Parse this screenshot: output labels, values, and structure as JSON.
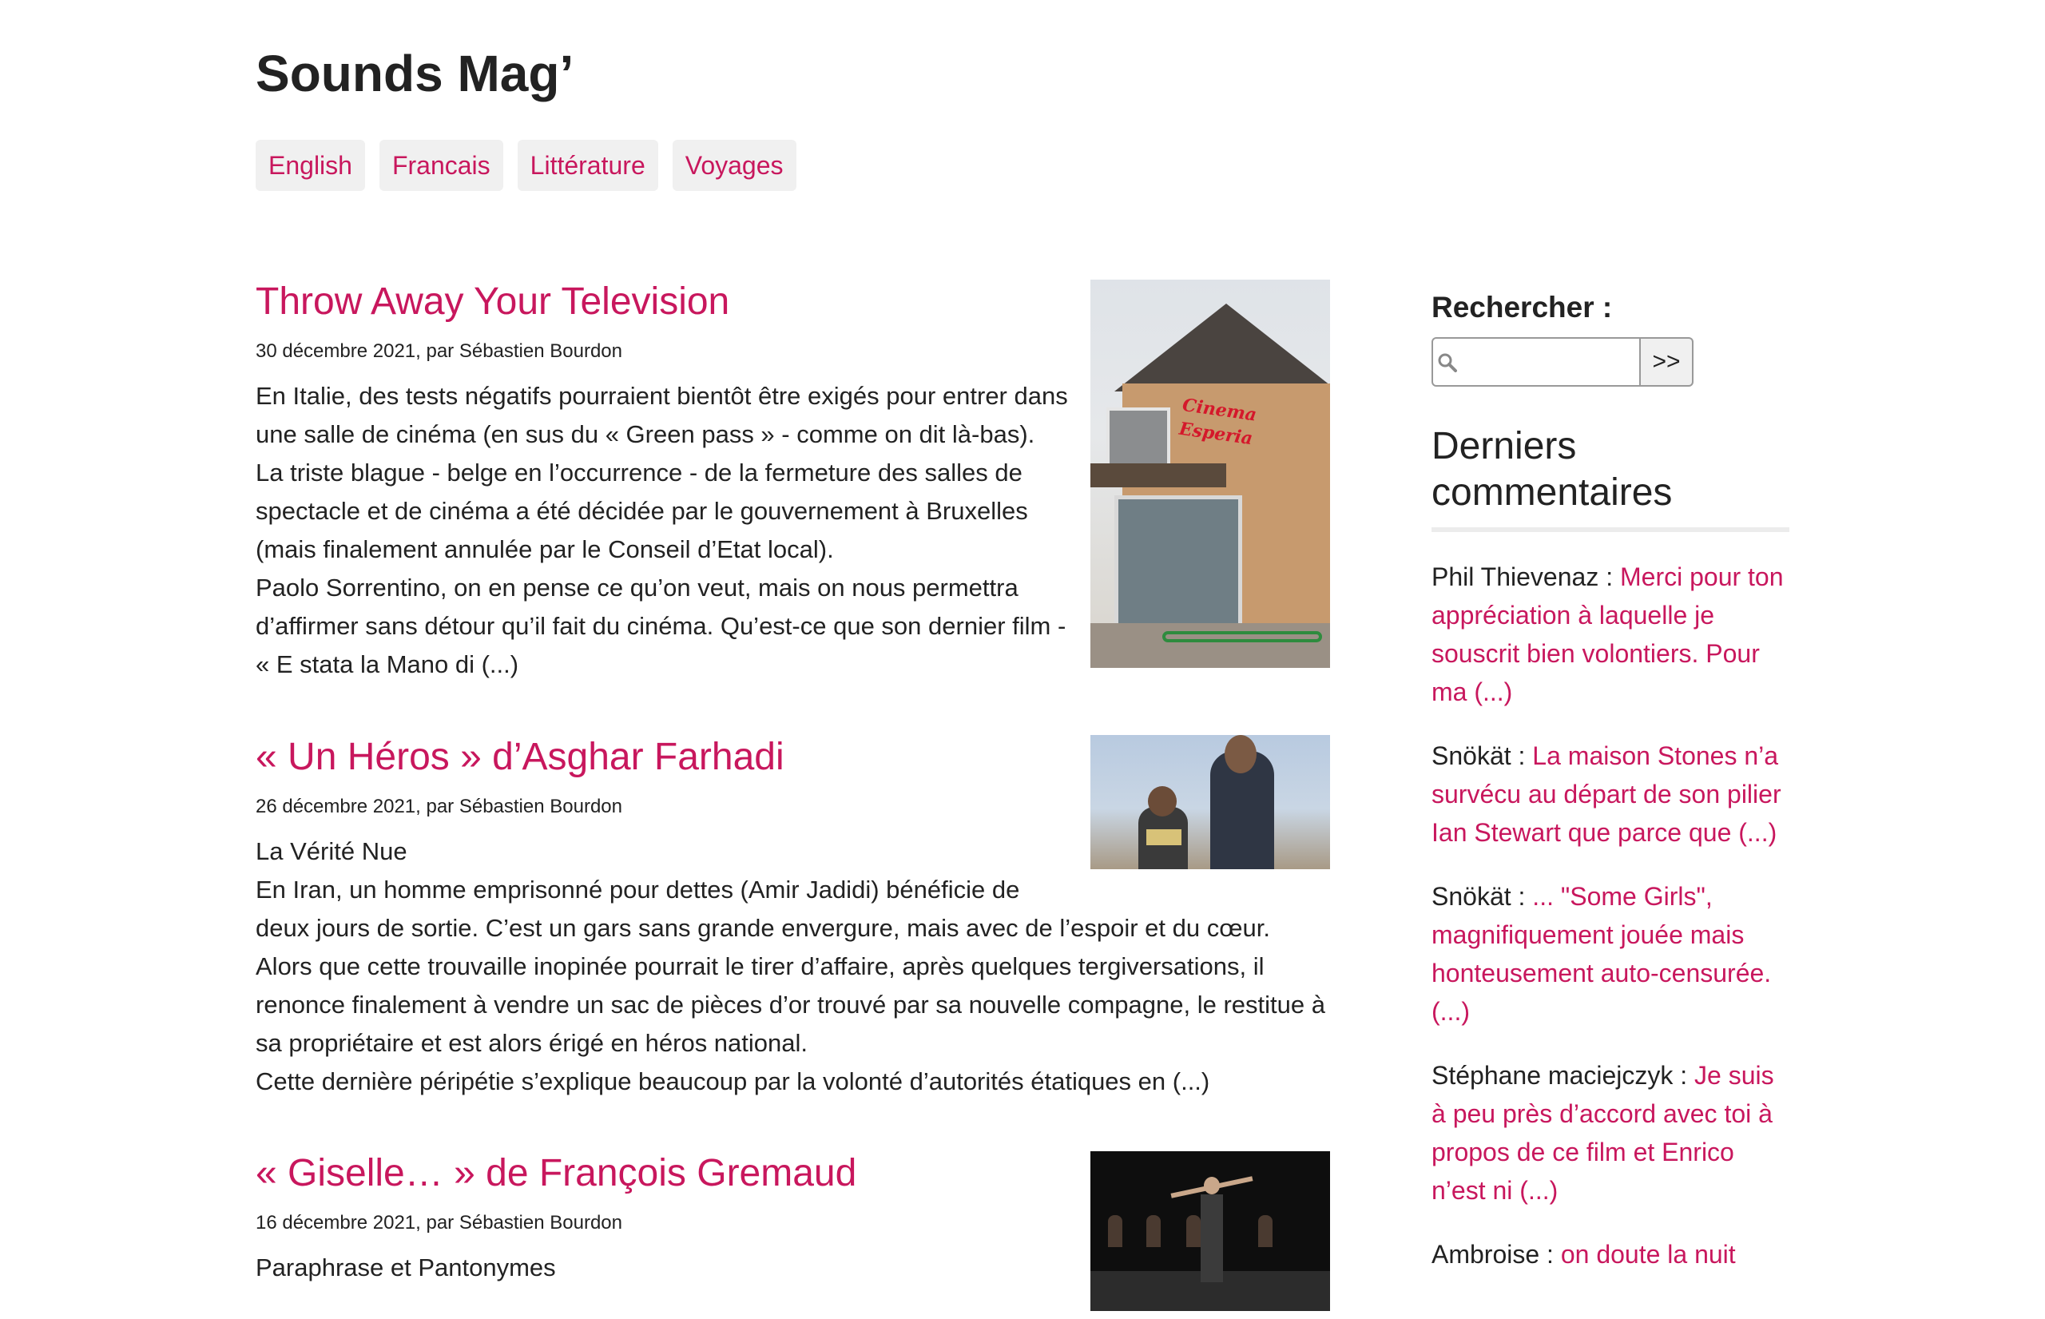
{
  "site": {
    "title": "Sounds Mag’"
  },
  "nav": {
    "items": [
      {
        "label": "English"
      },
      {
        "label": "Francais"
      },
      {
        "label": "Littérature"
      },
      {
        "label": "Voyages"
      }
    ]
  },
  "posts": [
    {
      "title": "Throw Away Your Television",
      "meta": "30 décembre 2021, par Sébastien Bourdon",
      "excerpt": [
        "En Italie, des tests négatifs pourraient bientôt être exigés pour entrer dans une salle de cinéma (en sus du « Green pass » - comme on dit là-bas). La triste blague - belge en l’occurrence - de la fermeture des salles de spectacle et de cinéma a été décidée par le gouvernement à Bruxelles (mais finalement annulée par le Conseil d’Etat local).",
        "Paolo Sorrentino, on en pense ce qu’on veut, mais on nous permettra d’affirmer sans détour qu’il fait du cinéma. Qu’est-ce que son dernier film - « E stata la Mano di (...)"
      ],
      "thumb_sign": [
        "Cinema",
        "Esperia"
      ]
    },
    {
      "title": "« Un Héros » d’Asghar Farhadi",
      "meta": "26 décembre 2021, par Sébastien Bourdon",
      "excerpt": [
        "La Vérité Nue",
        "En Iran, un homme emprisonné pour dettes (Amir Jadidi) bénéficie de deux jours de sortie. C’est un gars sans grande envergure, mais avec de l’espoir et du cœur. Alors que cette trouvaille inopinée pourrait le tirer d’affaire, après quelques tergiversations, il renonce finalement à vendre un sac de pièces d’or trouvé par sa nouvelle compagne, le restitue à sa propriétaire et est alors érigé en héros national.",
        "Cette dernière péripétie s’explique beaucoup par la volonté d’autorités étatiques en (...)"
      ]
    },
    {
      "title": "« Giselle… » de François Gremaud",
      "meta": "16 décembre 2021, par Sébastien Bourdon",
      "excerpt": [
        "Paraphrase et Pantonymes"
      ]
    }
  ],
  "sidebar": {
    "search": {
      "label": "Rechercher :",
      "button": ">>",
      "value": ""
    },
    "comments_title": "Derniers commentaires",
    "comments": [
      {
        "author": "Phil Thievenaz  : ",
        "excerpt": "Merci pour ton appréciation à laquelle je souscrit bien volontiers. Pour ma (...)"
      },
      {
        "author": "Snökät : ",
        "excerpt": "La maison Stones n’a survécu au départ de son pilier Ian Stewart que parce que (...)"
      },
      {
        "author": "Snökät : ",
        "excerpt": "... \"Some Girls\", magnifiquement jouée mais honteusement auto-censurée. (...)"
      },
      {
        "author": "Stéphane maciejczyk  : ",
        "excerpt": "Je suis à peu près d’accord avec toi à propos de ce film et Enrico n’est ni (...)"
      },
      {
        "author": "Ambroise : ",
        "excerpt": "on doute la nuit"
      }
    ]
  }
}
